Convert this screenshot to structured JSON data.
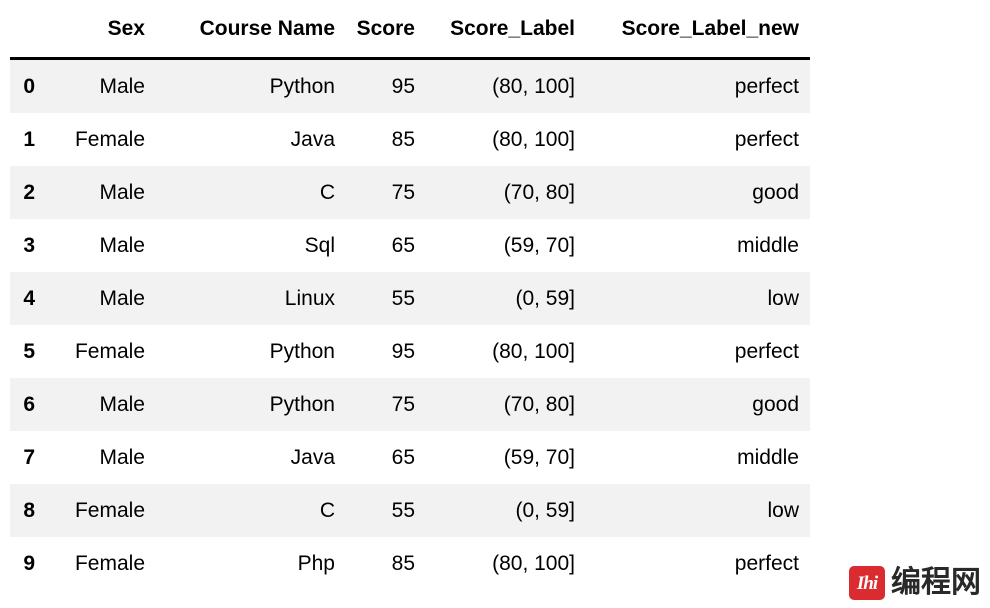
{
  "table": {
    "index_header": "",
    "columns": [
      "Sex",
      "Course Name",
      "Score",
      "Score_Label",
      "Score_Label_new"
    ],
    "rows": [
      {
        "index": "0",
        "sex": "Male",
        "course": "Python",
        "score": "95",
        "score_label": "(80, 100]",
        "score_label_new": "perfect"
      },
      {
        "index": "1",
        "sex": "Female",
        "course": "Java",
        "score": "85",
        "score_label": "(80, 100]",
        "score_label_new": "perfect"
      },
      {
        "index": "2",
        "sex": "Male",
        "course": "C",
        "score": "75",
        "score_label": "(70, 80]",
        "score_label_new": "good"
      },
      {
        "index": "3",
        "sex": "Male",
        "course": "Sql",
        "score": "65",
        "score_label": "(59, 70]",
        "score_label_new": "middle"
      },
      {
        "index": "4",
        "sex": "Male",
        "course": "Linux",
        "score": "55",
        "score_label": "(0, 59]",
        "score_label_new": "low"
      },
      {
        "index": "5",
        "sex": "Female",
        "course": "Python",
        "score": "95",
        "score_label": "(80, 100]",
        "score_label_new": "perfect"
      },
      {
        "index": "6",
        "sex": "Male",
        "course": "Python",
        "score": "75",
        "score_label": "(70, 80]",
        "score_label_new": "good"
      },
      {
        "index": "7",
        "sex": "Male",
        "course": "Java",
        "score": "65",
        "score_label": "(59, 70]",
        "score_label_new": "middle"
      },
      {
        "index": "8",
        "sex": "Female",
        "course": "C",
        "score": "55",
        "score_label": "(0, 59]",
        "score_label_new": "low"
      },
      {
        "index": "9",
        "sex": "Female",
        "course": "Php",
        "score": "85",
        "score_label": "(80, 100]",
        "score_label_new": "perfect"
      }
    ]
  },
  "watermark": {
    "badge_text": "Ihi",
    "site_name": "编程网",
    "badge_color": "#d9262a",
    "text_color": "#232323"
  },
  "style": {
    "stripe_color": "#f2f2f2",
    "background": "#ffffff",
    "rule_color": "#000000"
  }
}
